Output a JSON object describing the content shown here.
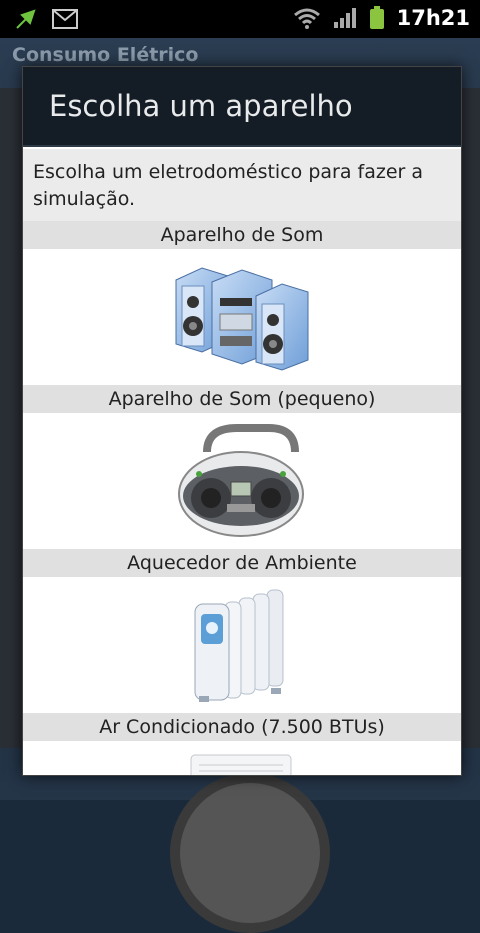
{
  "status_bar": {
    "time": "17h21",
    "icons": [
      "usb-debug-icon",
      "gmail-icon",
      "wifi-icon",
      "signal-icon",
      "battery-icon"
    ]
  },
  "background_app": {
    "title": "Consumo Elétrico"
  },
  "dialog": {
    "title": "Escolha um aparelho",
    "description": "Escolha um eletrodoméstico para fazer a simulação.",
    "items": [
      {
        "label": "Aparelho de Som",
        "icon": "stereo-system-icon"
      },
      {
        "label": "Aparelho de Som (pequeno)",
        "icon": "boombox-icon"
      },
      {
        "label": "Aquecedor de Ambiente",
        "icon": "oil-heater-icon"
      },
      {
        "label": "Ar Condicionado (7.500 BTUs)",
        "icon": "air-conditioner-icon"
      }
    ]
  },
  "colors": {
    "accent_battery": "#8bc53f",
    "dialog_header": "#141c25",
    "label_bar": "#e0e0e0"
  }
}
